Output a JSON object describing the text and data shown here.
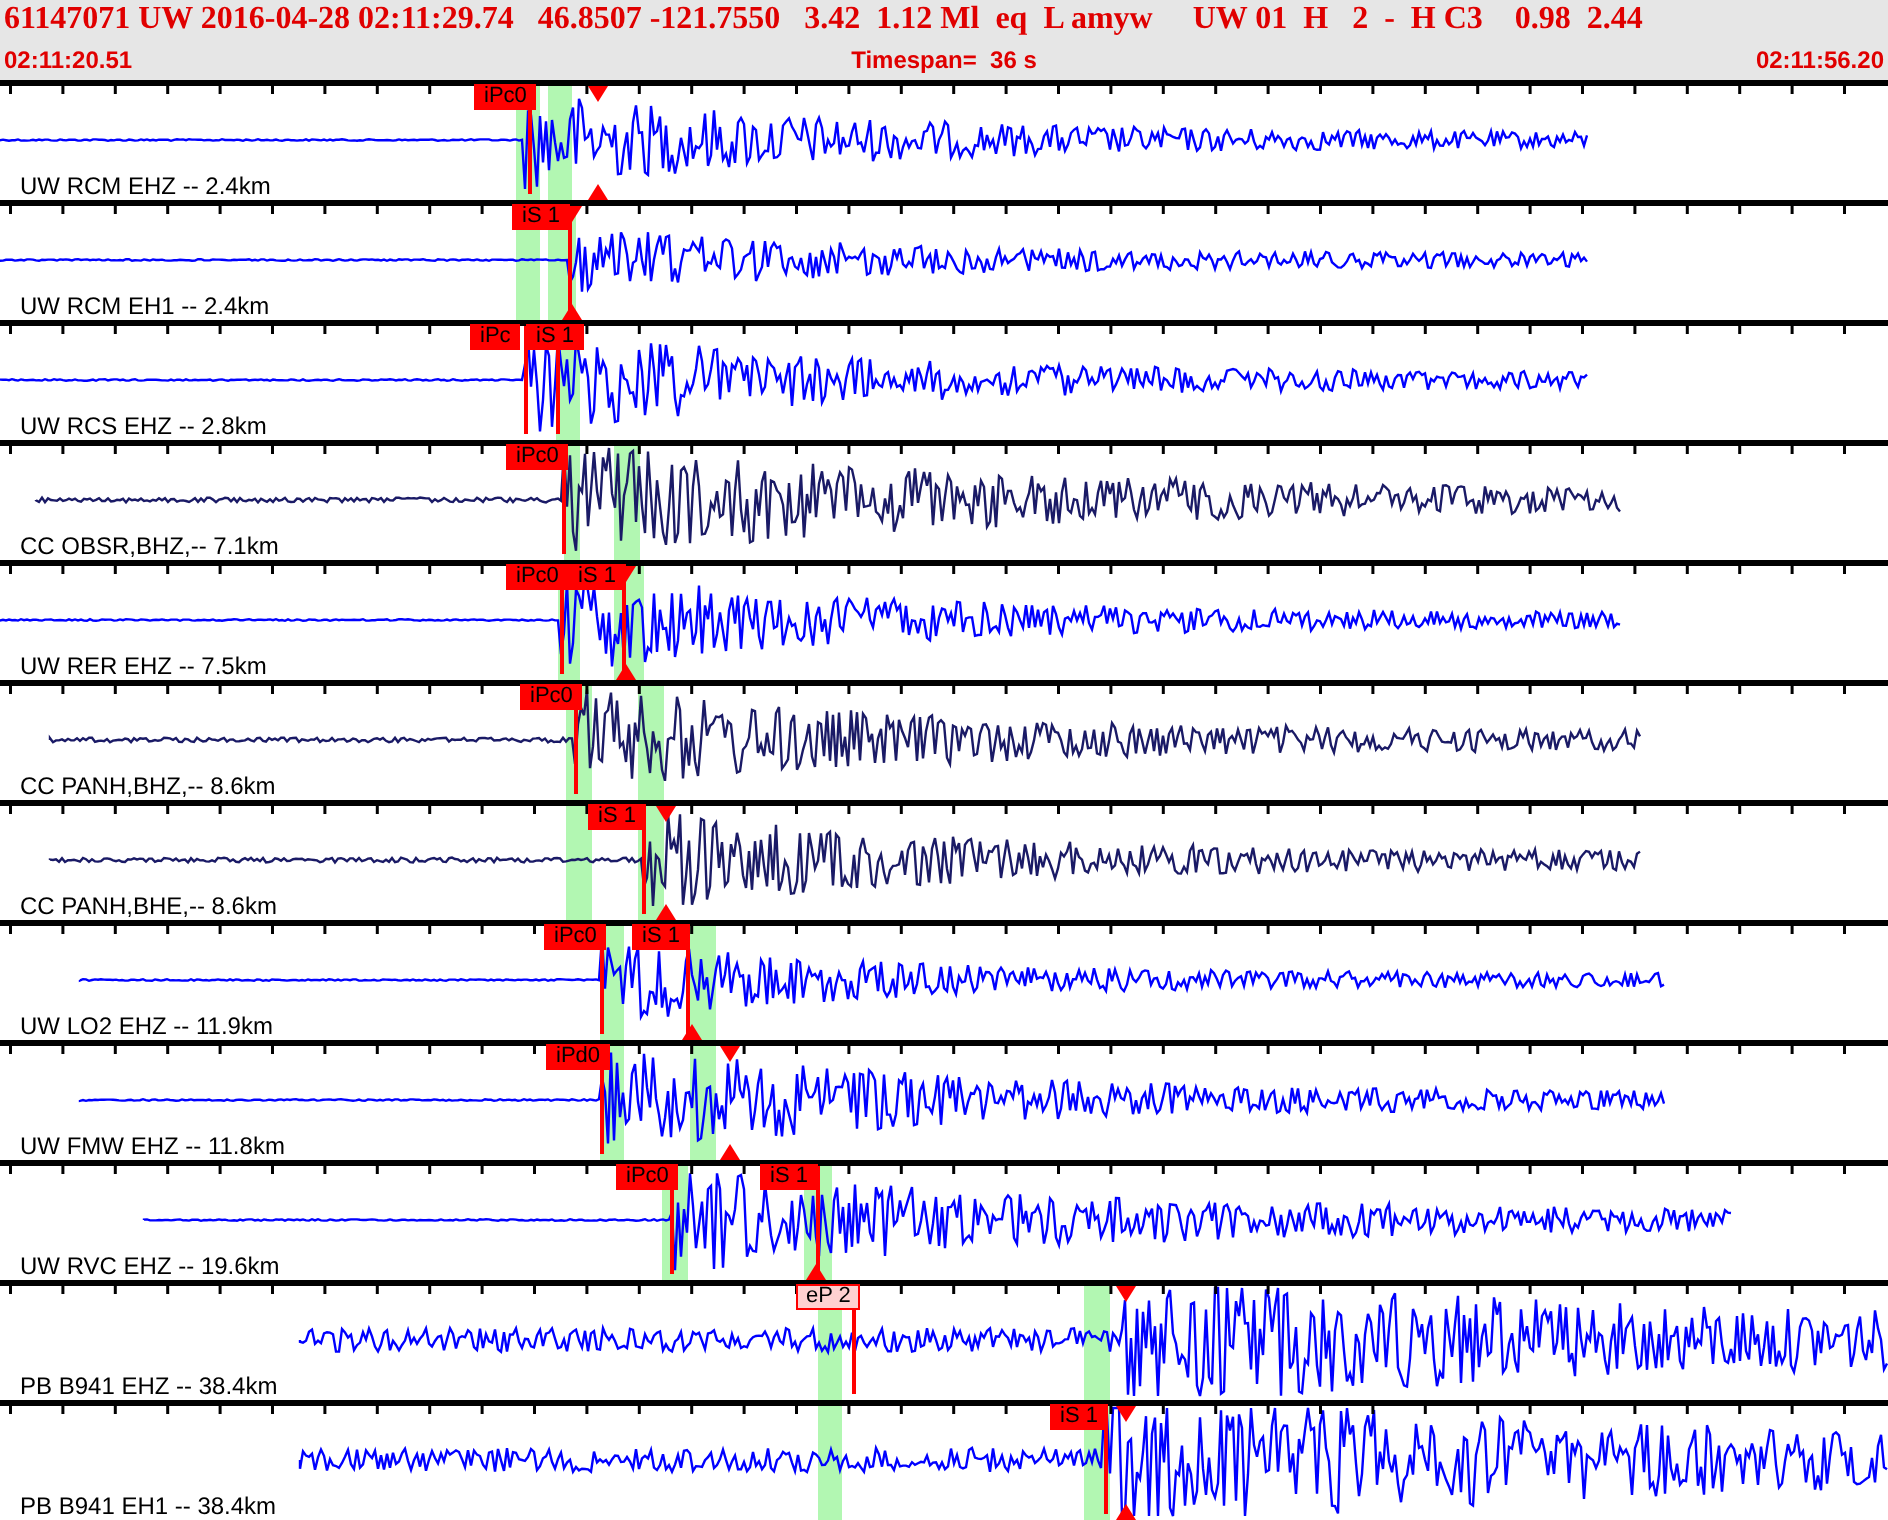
{
  "header": {
    "event_line": "61147071 UW 2016-04-28 02:11:29.74   46.8507 -121.7550   3.42  1.12 Ml  eq  L amyw     UW 01  H   2  -  H C3    0.98  2.44",
    "start_time": "02:11:20.51",
    "timespan": "Timespan=  36 s",
    "end_time": "02:11:56.20"
  },
  "traces": [
    {
      "label": "UW RCM EHZ -- 2.4km",
      "color": "#0000ff",
      "picks": [
        {
          "label": "iPc0",
          "kind": "solid"
        }
      ]
    },
    {
      "label": "UW RCM EH1 -- 2.4km",
      "color": "#0000ff",
      "picks": [
        {
          "label": "iS 1",
          "kind": "solid"
        }
      ]
    },
    {
      "label": "UW RCS EHZ -- 2.8km",
      "color": "#0000ff",
      "picks": [
        {
          "label": "iPc",
          "kind": "solid"
        },
        {
          "label": "iS 1",
          "kind": "solid"
        }
      ]
    },
    {
      "label": "CC OBSR,BHZ,-- 7.1km",
      "color": "#1a1a66",
      "picks": [
        {
          "label": "iPc0",
          "kind": "solid"
        }
      ]
    },
    {
      "label": "UW RER EHZ -- 7.5km",
      "color": "#0000ff",
      "picks": [
        {
          "label": "iPc0",
          "kind": "solid"
        },
        {
          "label": "iS 1",
          "kind": "solid"
        }
      ]
    },
    {
      "label": "CC PANH,BHZ,-- 8.6km",
      "color": "#1a1a66",
      "picks": [
        {
          "label": "iPc0",
          "kind": "solid"
        }
      ]
    },
    {
      "label": "CC PANH,BHE,-- 8.6km",
      "color": "#1a1a66",
      "picks": [
        {
          "label": "iS 1",
          "kind": "solid"
        }
      ]
    },
    {
      "label": "UW LO2 EHZ -- 11.9km",
      "color": "#0000ff",
      "picks": [
        {
          "label": "iPc0",
          "kind": "solid"
        },
        {
          "label": "iS 1",
          "kind": "solid"
        }
      ]
    },
    {
      "label": "UW FMW EHZ -- 11.8km",
      "color": "#0000ff",
      "picks": [
        {
          "label": "iPd0",
          "kind": "solid"
        }
      ]
    },
    {
      "label": "UW RVC EHZ -- 19.6km",
      "color": "#0000ff",
      "picks": [
        {
          "label": "iPc0",
          "kind": "solid"
        },
        {
          "label": "iS 1",
          "kind": "solid"
        }
      ]
    },
    {
      "label": "PB B941 EHZ -- 38.4km",
      "color": "#0000ff",
      "picks": [
        {
          "label": "eP 2",
          "kind": "outline"
        }
      ]
    },
    {
      "label": "PB B941 EH1 -- 38.4km",
      "color": "#0000ff",
      "picks": [
        {
          "label": "iS 1",
          "kind": "solid"
        }
      ]
    }
  ]
}
